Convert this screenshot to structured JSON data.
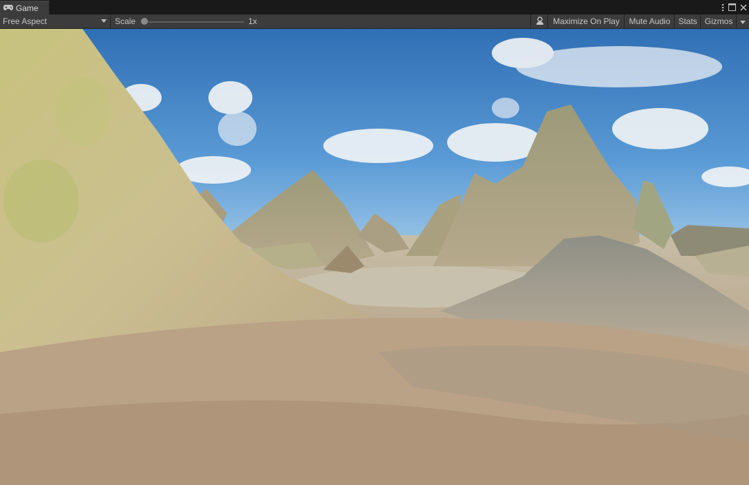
{
  "tab": {
    "title": "Game",
    "icon": "gamepad-icon"
  },
  "window_controls": {
    "menu_icon": "kebab-menu-icon",
    "maximize_icon": "maximize-icon",
    "close_icon": "close-icon"
  },
  "toolbar": {
    "aspect": "Free Aspect",
    "scale_label": "Scale",
    "scale_value": "1x",
    "scale_fraction": 0.0,
    "buttons": {
      "audio_icon": "audio-settings-icon",
      "maximize_on_play": "Maximize On Play",
      "mute_audio": "Mute Audio",
      "stats": "Stats",
      "gizmos": "Gizmos"
    }
  },
  "viewport": {
    "scene": "terrain-landscape",
    "sky_color": "#3f82c4",
    "ground_color": "#b8a48a"
  }
}
